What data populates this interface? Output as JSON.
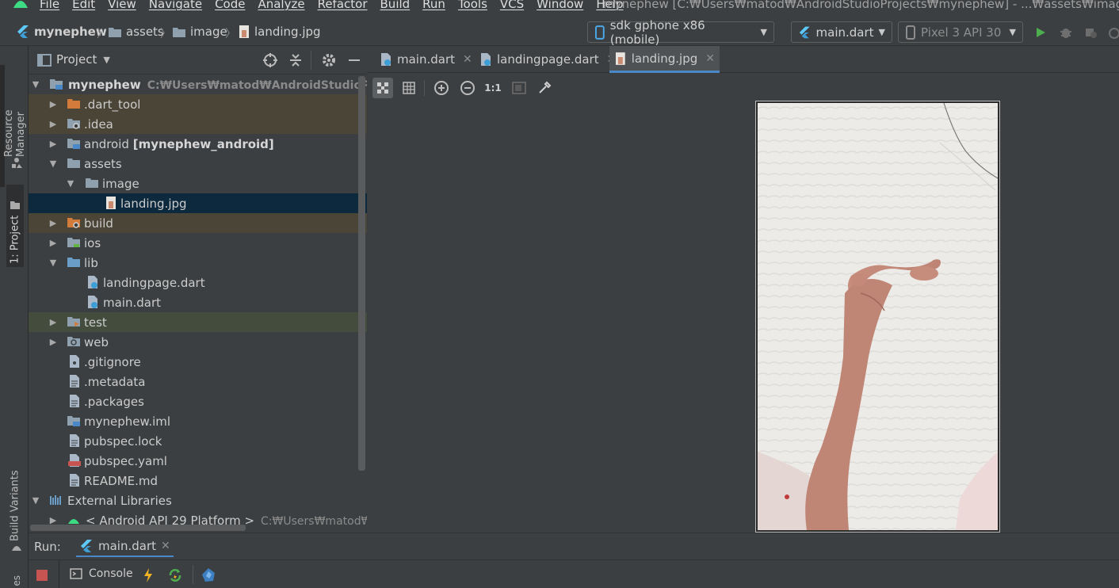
{
  "menubar": {
    "items": [
      "File",
      "Edit",
      "View",
      "Navigate",
      "Code",
      "Analyze",
      "Refactor",
      "Build",
      "Run",
      "Tools",
      "VCS",
      "Window",
      "Help"
    ],
    "window_title": "mynephew [C:₩Users₩matod₩AndroidStudioProjects₩mynephew] - ...₩assets₩image₩landing.jpg"
  },
  "navbar": {
    "breadcrumbs": [
      "mynephew",
      "assets",
      "image",
      "landing.jpg"
    ],
    "device_selector": "sdk gphone x86 (mobile)",
    "run_config": "main.dart",
    "avd_selector": "Pixel 3 API 30"
  },
  "leftstrip": {
    "resource_manager": "Resource Manager",
    "project": "1: Project",
    "build_variants": "Build Variants"
  },
  "project_panel": {
    "view_label": "Project",
    "root_name": "mynephew",
    "root_path": "C:₩Users₩matod₩AndroidStudioProjects₩",
    "items": [
      {
        "label": ".dart_tool"
      },
      {
        "label": ".idea"
      },
      {
        "label": "android",
        "bold_suffix": "[mynephew_android]"
      },
      {
        "label": "assets"
      },
      {
        "label": "image"
      },
      {
        "label": "landing.jpg"
      },
      {
        "label": "build"
      },
      {
        "label": "ios"
      },
      {
        "label": "lib"
      },
      {
        "label": "landingpage.dart"
      },
      {
        "label": "main.dart"
      },
      {
        "label": "test"
      },
      {
        "label": "web"
      },
      {
        "label": ".gitignore"
      },
      {
        "label": ".metadata"
      },
      {
        "label": ".packages"
      },
      {
        "label": "mynephew.iml"
      },
      {
        "label": "pubspec.lock"
      },
      {
        "label": "pubspec.yaml"
      },
      {
        "label": "README.md"
      },
      {
        "label": "External Libraries"
      },
      {
        "label": "< Android API 29 Platform >",
        "path": "C:₩Users₩matod₩App"
      }
    ]
  },
  "editor": {
    "tabs": [
      "main.dart",
      "landingpage.dart",
      "landing.jpg"
    ],
    "active_tab": "landing.jpg",
    "zoom_actual": "1:1"
  },
  "run_panel": {
    "label": "Run:",
    "tab": "main.dart",
    "console": "Console"
  },
  "colors": {
    "background": "#3c3f41",
    "selection": "#0d293e",
    "excluded": "#4a4536",
    "accent": "#4a88c7",
    "run_green": "#4cae4f",
    "stop_red": "#c75450"
  }
}
